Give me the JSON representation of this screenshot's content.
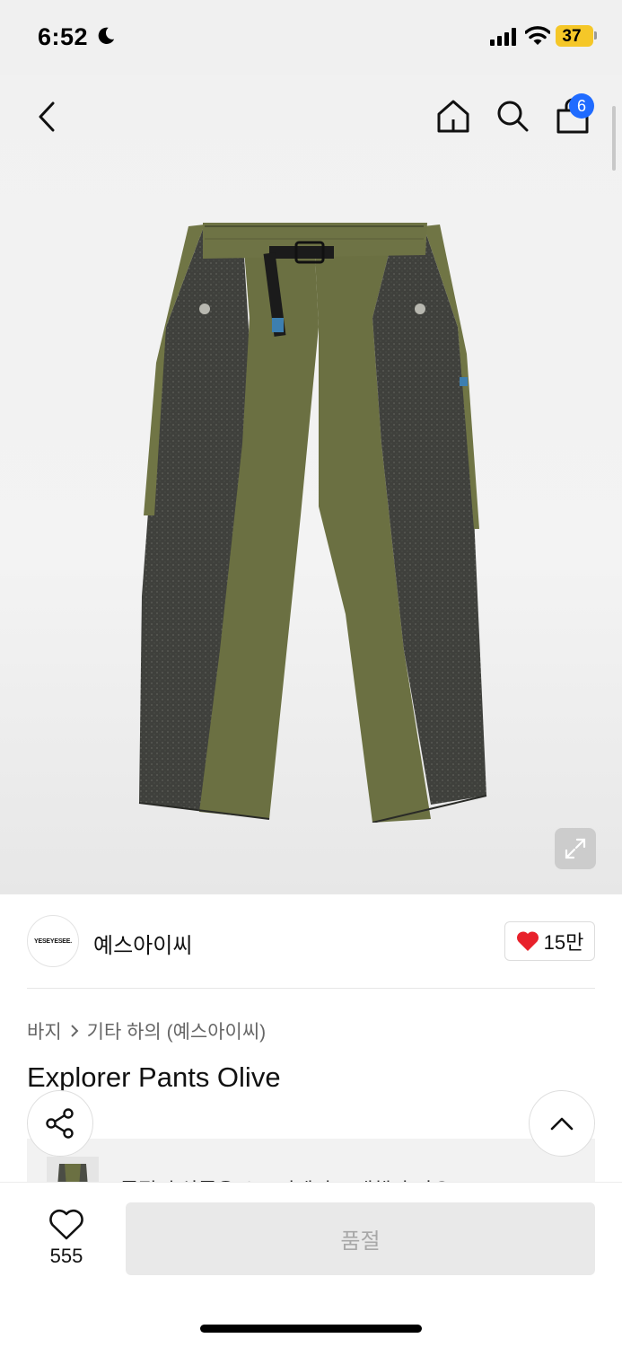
{
  "status_bar": {
    "time": "6:52",
    "battery": "37",
    "icons": [
      "moon-icon",
      "signal-icon",
      "wifi-icon",
      "battery-icon"
    ],
    "battery_color": "#f5c728"
  },
  "header": {
    "icons": [
      "back-arrow-icon",
      "home-icon",
      "search-icon",
      "shopping-bag-icon"
    ],
    "cart_badge": "6",
    "badge_color": "#1f6bff"
  },
  "brand": {
    "logo_text": "YESEYESEE.",
    "name": "예스아이씨",
    "like_count": "15만",
    "like_color": "#e8212b"
  },
  "breadcrumb": {
    "category": "바지",
    "subcategory": "기타 하의 (예스아이씨)"
  },
  "product": {
    "title": "Explorer Pants Olive",
    "image_icon": "pants-image"
  },
  "toast": {
    "text": "품절된 상품은 스토어에서 구매했나 봐요",
    "arrow": "›"
  },
  "bottom_bar": {
    "wish_count": "555",
    "soldout_label": "품절"
  }
}
